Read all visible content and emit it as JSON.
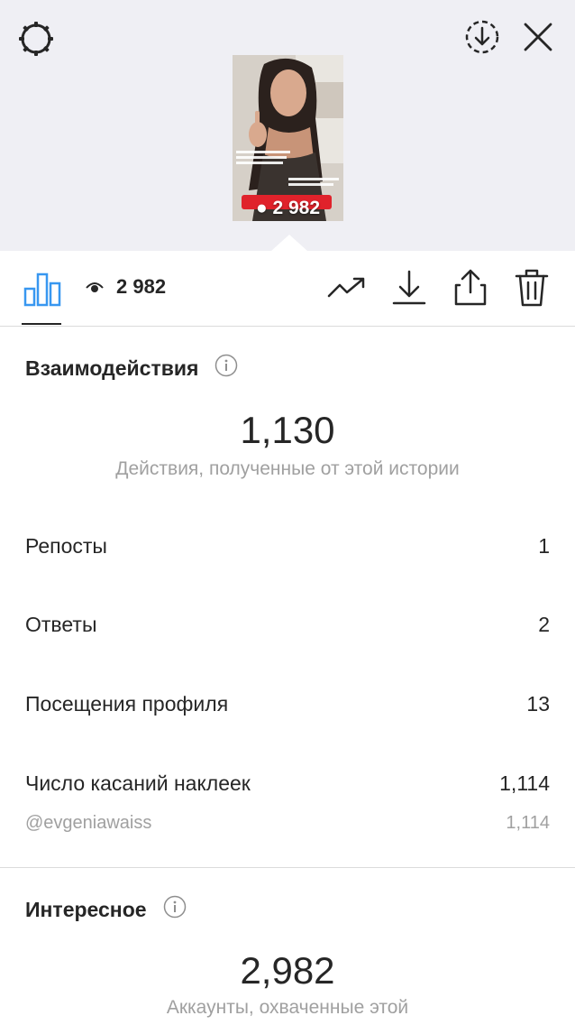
{
  "story_preview": {
    "overlay_views": "2 982"
  },
  "toolbar": {
    "views_count": "2 982",
    "icons": [
      "bar-chart-icon",
      "eye-icon",
      "trending-up-icon",
      "download-icon",
      "share-icon",
      "trash-icon"
    ]
  },
  "header_icons": [
    "settings-icon",
    "save-icon",
    "close-icon"
  ],
  "interactions": {
    "title": "Взаимодействия",
    "total": "1,130",
    "caption": "Действия, полученные от этой истории",
    "rows": [
      {
        "label": "Репосты",
        "value": "1"
      },
      {
        "label": "Ответы",
        "value": "2"
      },
      {
        "label": "Посещения профиля",
        "value": "13"
      },
      {
        "label": "Число касаний наклеек",
        "value": "1,114"
      }
    ],
    "sticker": {
      "label": "@evgeniawaiss",
      "value": "1,114"
    }
  },
  "discovery": {
    "title": "Интересное",
    "total": "2,982",
    "caption": "Аккаунты, охваченные этой"
  },
  "colors": {
    "top_background": "#efeff4",
    "text_primary": "#262626",
    "text_secondary": "#a0a0a0",
    "divider": "#dbdbdb",
    "active_tab": "#3897f0"
  }
}
